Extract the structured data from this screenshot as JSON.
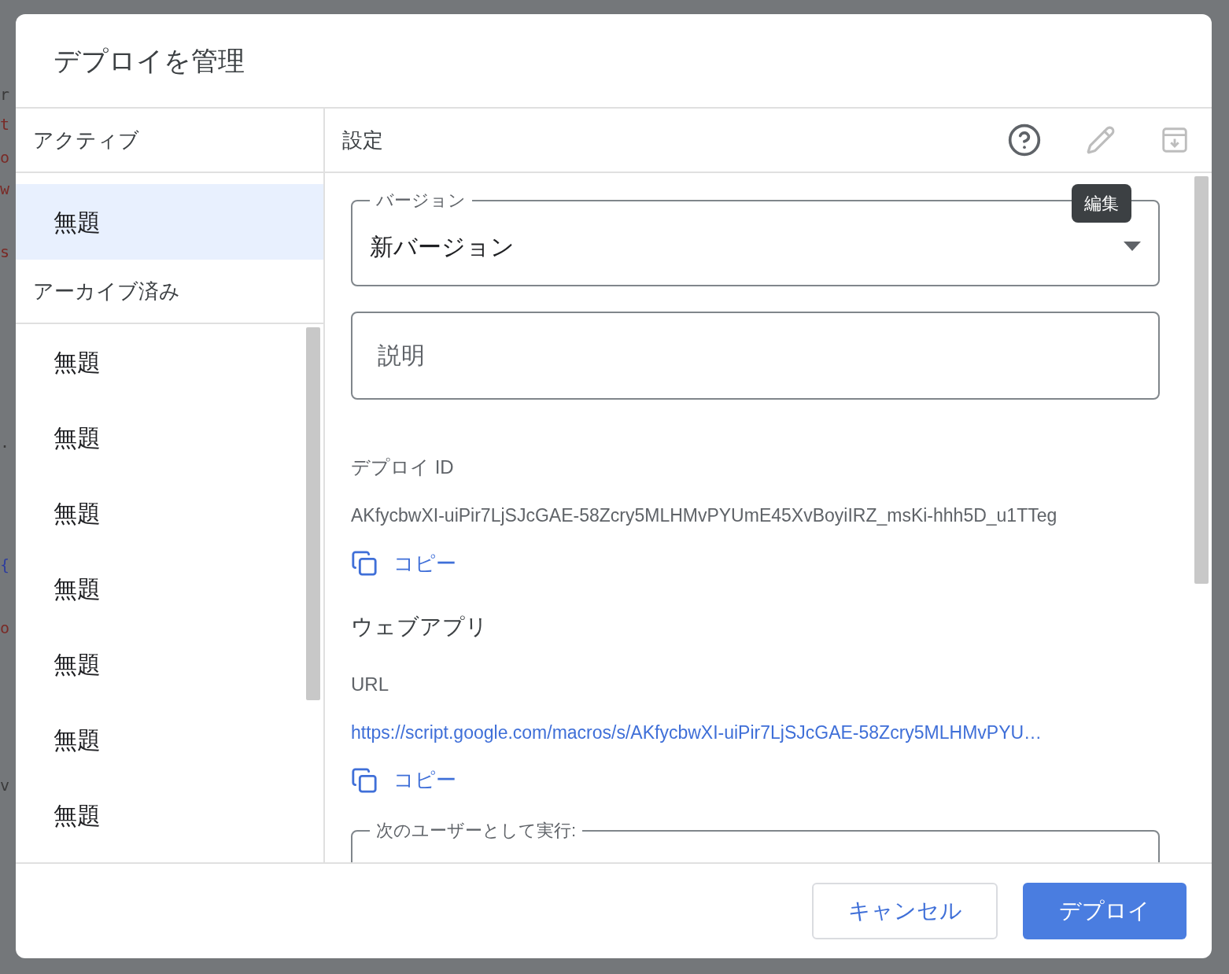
{
  "background_code": [
    {
      "text": "r",
      "color": "#3a3a3a"
    },
    {
      "text": "t",
      "color": "#7a2a26"
    },
    {
      "text": "o",
      "color": "#7a2a26"
    },
    {
      "text": "w",
      "color": "#7a2a26"
    },
    {
      "text": "s",
      "color": "#7a2a26"
    },
    {
      "text": ".",
      "color": "#3a3a3a"
    },
    {
      "text": "{",
      "color": "#2d3d9e"
    },
    {
      "text": "o",
      "color": "#7a2a26"
    },
    {
      "text": "v",
      "color": "#3a3a3a"
    }
  ],
  "dialog": {
    "title": "デプロイを管理"
  },
  "sidebar": {
    "sections": [
      {
        "heading": "アクティブ",
        "items": [
          {
            "label": "無題",
            "selected": true
          }
        ]
      },
      {
        "heading": "アーカイブ済み",
        "items": [
          {
            "label": "無題",
            "selected": false
          },
          {
            "label": "無題",
            "selected": false
          },
          {
            "label": "無題",
            "selected": false
          },
          {
            "label": "無題",
            "selected": false
          },
          {
            "label": "無題",
            "selected": false
          },
          {
            "label": "無題",
            "selected": false
          },
          {
            "label": "無題",
            "selected": false
          }
        ]
      }
    ]
  },
  "settings": {
    "heading": "設定",
    "tooltip": "編集",
    "version": {
      "label": "バージョン",
      "value": "新バージョン"
    },
    "description": {
      "placeholder": "説明"
    },
    "deploy_id": {
      "label": "デプロイ ID",
      "value": "AKfycbwXI-uiPir7LjSJcGAE-58Zcry5MLHMvPYUmE45XvBoyiIRZ_msKi-hhh5D_u1TTeg",
      "copy": "コピー"
    },
    "web_app": {
      "heading": "ウェブアプリ",
      "url_label": "URL",
      "url": "https://script.google.com/macros/s/AKfycbwXI-uiPir7LjSJcGAE-58Zcry5MLHMvPYU…",
      "copy": "コピー"
    },
    "execute_as": {
      "label": "次のユーザーとして実行:"
    }
  },
  "footer": {
    "buttons": [
      {
        "label": "キャンセル",
        "kind": "secondary"
      },
      {
        "label": "デプロイ",
        "kind": "primary"
      }
    ]
  }
}
